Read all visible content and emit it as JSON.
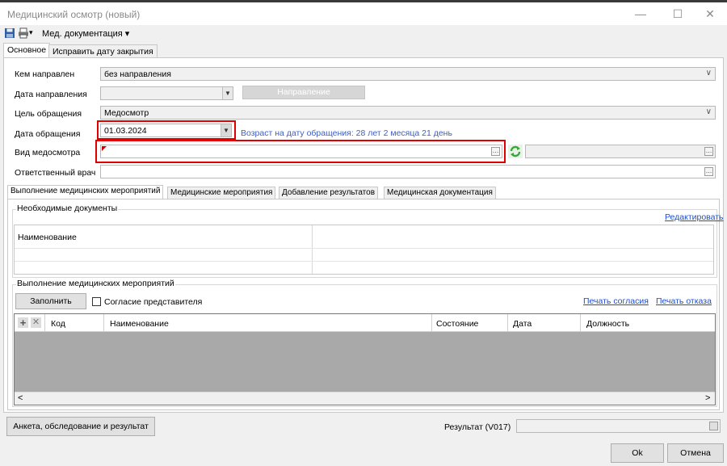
{
  "window": {
    "title": "Медицинский осмотр (новый)",
    "minimize_glyph": "—",
    "maximize_glyph": "☐",
    "close_glyph": "✕"
  },
  "toolbar": {
    "menu_label": "Мед. документация ▾",
    "save_icon": "floppy-disk-icon",
    "print_icon": "printer-icon"
  },
  "tabs": [
    {
      "label": "Основное"
    },
    {
      "label": "Исправить дату закрытия"
    }
  ],
  "form": {
    "referred_by": {
      "label": "Кем направлен",
      "value": "без направления"
    },
    "referral_date": {
      "label": "Дата направления",
      "value": "",
      "button": "Направление"
    },
    "purpose": {
      "label": "Цель обращения",
      "value": "Медосмотр"
    },
    "visit_date": {
      "label": "Дата обращения",
      "value": "01.03.2024",
      "age_note": "Возраст на дату обращения: 28 лет 2 месяца 21 день"
    },
    "exam_type": {
      "label": "Вид медосмотра",
      "value": ""
    },
    "doctor": {
      "label": "Ответственный врач",
      "value": ""
    }
  },
  "subtabs": [
    {
      "label": "Выполнение медицинских мероприятий"
    },
    {
      "label": "Медицинские мероприятия"
    },
    {
      "label": "Добавление результатов"
    },
    {
      "label": "Медицинская документация"
    }
  ],
  "required_docs": {
    "title": "Необходимые документы",
    "edit_link": "Редактировать",
    "col_name": "Наименование"
  },
  "activities": {
    "title": "Выполнение медицинских мероприятий",
    "fill_button": "Заполнить",
    "consent_checkbox": "Согласие представителя",
    "print_consent_link": "Печать согласия",
    "print_refusal_link": "Печать отказа",
    "columns": [
      "Код",
      "Наименование",
      "Состояние",
      "Дата",
      "Должность"
    ],
    "scroll_left": "<",
    "scroll_right": ">"
  },
  "footer": {
    "survey_button": "Анкета, обследование и результат",
    "result_label": "Результат (V017)",
    "result_value": "",
    "ok_button": "Ok",
    "cancel_button": "Отмена"
  },
  "colors": {
    "highlight": "#e00000",
    "link": "#1a4fcf",
    "age_note": "#3b5fc4"
  }
}
